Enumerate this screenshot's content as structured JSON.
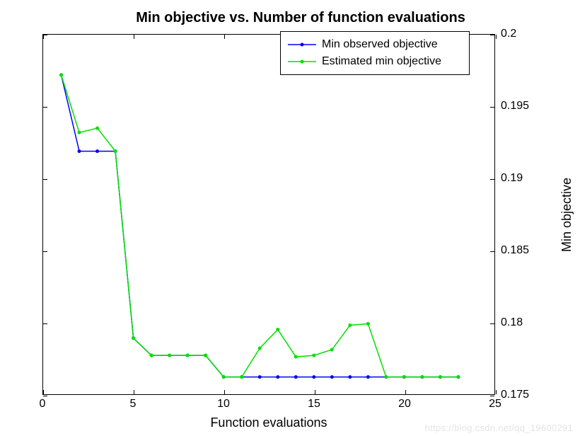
{
  "chart_data": {
    "type": "line",
    "title": "Min objective vs. Number of function evaluations",
    "xlabel": "Function evaluations",
    "ylabel": "Min objective",
    "xlim": [
      0,
      25
    ],
    "ylim": [
      0.175,
      0.2
    ],
    "x_ticks": [
      0,
      5,
      10,
      15,
      20,
      25
    ],
    "y_ticks": [
      0.175,
      0.18,
      0.185,
      0.19,
      0.195,
      0.2
    ],
    "y_tick_labels": [
      "0.175",
      "0.18",
      "0.185",
      "0.19",
      "0.195",
      "0.2"
    ],
    "series": [
      {
        "name": "Min observed objective",
        "color": "#0000ff",
        "x": [
          1,
          2,
          3,
          4,
          5,
          6,
          7,
          8,
          9,
          10,
          11,
          12,
          13,
          14,
          15,
          16,
          17,
          18,
          19,
          20,
          21,
          22,
          23
        ],
        "values": [
          0.1972,
          0.1919,
          0.1919,
          0.1919,
          0.1789,
          0.1777,
          0.1777,
          0.1777,
          0.1777,
          0.1762,
          0.1762,
          0.1762,
          0.1762,
          0.1762,
          0.1762,
          0.1762,
          0.1762,
          0.1762,
          0.1762,
          0.1762,
          0.1762,
          0.1762,
          0.1762
        ]
      },
      {
        "name": "Estimated min objective",
        "color": "#00e000",
        "x": [
          1,
          2,
          3,
          4,
          5,
          6,
          7,
          8,
          9,
          10,
          11,
          12,
          13,
          14,
          15,
          16,
          17,
          18,
          19,
          20,
          21,
          22,
          23
        ],
        "values": [
          0.1972,
          0.1932,
          0.1935,
          0.1919,
          0.1789,
          0.1777,
          0.1777,
          0.1777,
          0.1777,
          0.1762,
          0.1762,
          0.1782,
          0.1795,
          0.1776,
          0.1777,
          0.1781,
          0.1798,
          0.1799,
          0.1762,
          0.1762,
          0.1762,
          0.1762,
          0.1762
        ]
      }
    ],
    "legend_position": "top-right-inside",
    "grid": false
  },
  "watermark": "https://blog.csdn.net/qq_19600291"
}
